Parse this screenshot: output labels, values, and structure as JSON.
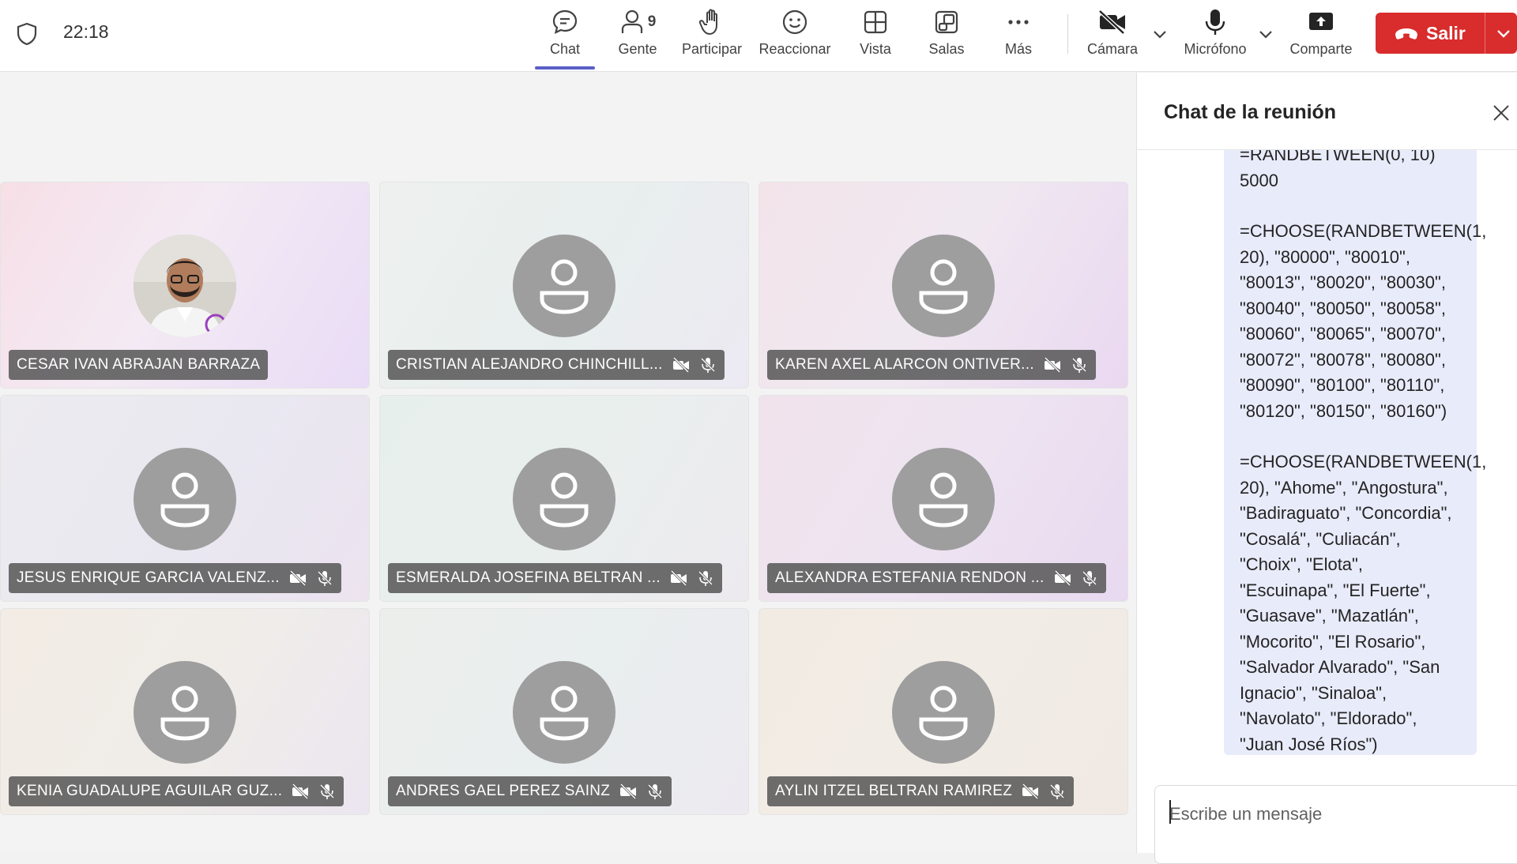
{
  "topbar": {
    "time": "22:18",
    "buttons": {
      "chat": "Chat",
      "people": "Gente",
      "people_count": "9",
      "raise": "Participar",
      "react": "Reaccionar",
      "view": "Vista",
      "rooms": "Salas",
      "more": "Más",
      "camera": "Cámara",
      "mic": "Micrófono",
      "share": "Comparte"
    },
    "leave": "Salir",
    "leave_color": "#d92c2c",
    "active_tab_color": "#5b5fc7"
  },
  "participants": [
    {
      "name": "CESAR IVAN ABRAJAN BARRAZA",
      "has_photo": true
    },
    {
      "name": "CRISTIAN ALEJANDRO CHINCHILL...",
      "has_photo": false
    },
    {
      "name": "KAREN AXEL ALARCON ONTIVER...",
      "has_photo": false
    },
    {
      "name": "JESUS ENRIQUE GARCIA VALENZ...",
      "has_photo": false
    },
    {
      "name": "ESMERALDA JOSEFINA BELTRAN ...",
      "has_photo": false
    },
    {
      "name": "ALEXANDRA ESTEFANIA RENDON ...",
      "has_photo": false
    },
    {
      "name": "KENIA GUADALUPE AGUILAR GUZ...",
      "has_photo": false
    },
    {
      "name": "ANDRES GAEL PEREZ SAINZ",
      "has_photo": false
    },
    {
      "name": "AYLIN ITZEL BELTRAN RAMIREZ",
      "has_photo": false
    }
  ],
  "chat": {
    "title": "Chat de la reunión",
    "message_partial_top": "=RANDBETWEEN(0, 10)",
    "message_line_1": "5000",
    "message_block_2": "=CHOOSE(RANDBETWEEN(1, 20), \"80000\", \"80010\", \"80013\", \"80020\", \"80030\", \"80040\", \"80050\", \"80058\", \"80060\", \"80065\", \"80070\", \"80072\", \"80078\", \"80080\", \"80090\", \"80100\", \"80110\", \"80120\", \"80150\", \"80160\")",
    "message_block_3": "=CHOOSE(RANDBETWEEN(1, 20), \"Ahome\", \"Angostura\", \"Badiraguato\", \"Concordia\", \"Cosalá\", \"Culiacán\", \"Choix\", \"Elota\", \"Escuinapa\", \"El Fuerte\", \"Guasave\", \"Mazatlán\", \"Mocorito\", \"El Rosario\", \"Salvador Alvarado\", \"San Ignacio\", \"Sinaloa\", \"Navolato\", \"Eldorado\", \"Juan José Ríos\")",
    "composer_placeholder": "Escribe un mensaje",
    "bubble_color": "#e8ebfa"
  }
}
